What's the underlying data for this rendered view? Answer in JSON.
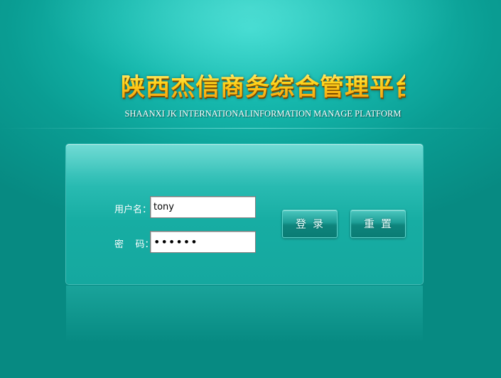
{
  "header": {
    "title_cn": "陕西杰信商务综合管理平台",
    "title_en": "SHAANXI JK INTERNATIONALINFORMATION MANAGE PLATFORM"
  },
  "login": {
    "username_label": "用户名：",
    "password_label": "密    码：",
    "username_value": "tony",
    "password_value": "••••••",
    "login_button": "登录",
    "reset_button": "重置"
  },
  "colors": {
    "background": "#0a9d93",
    "title_gold": "#ffd21a",
    "panel": "#2ebfb6",
    "button": "#1d9e96"
  }
}
